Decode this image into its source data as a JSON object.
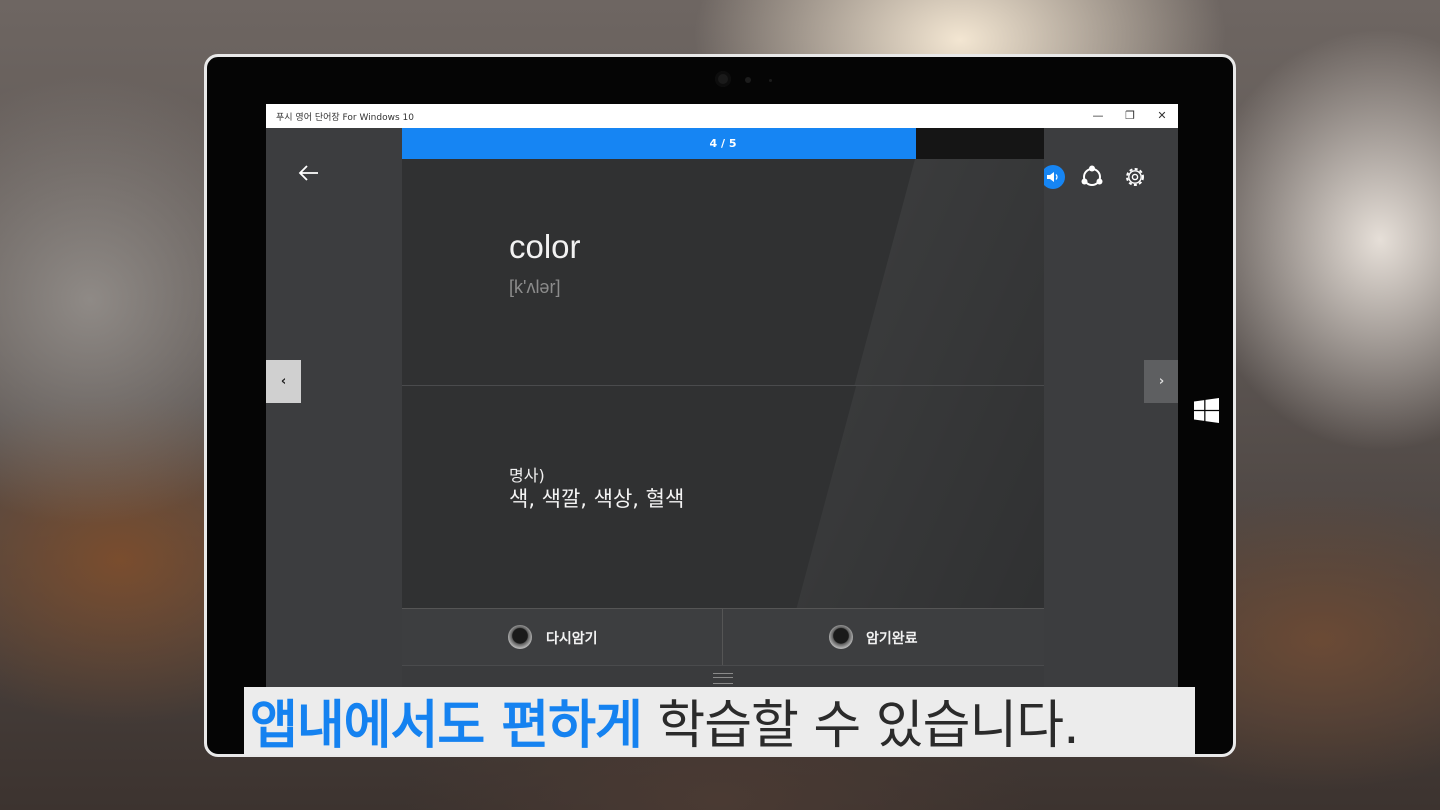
{
  "window": {
    "title": "푸시 영어 단어장 For Windows 10",
    "minimize": "—",
    "restore": "❐",
    "close": "✕"
  },
  "progress": {
    "label": "4 / 5",
    "value": 0.8,
    "color": "#1685f3"
  },
  "card": {
    "word": "color",
    "pronunciation": "[k'ʌlər]",
    "part_of_speech": "명사)",
    "meaning": "색, 색깔, 색상, 혈색"
  },
  "navigation": {
    "prev": "‹",
    "next": "›"
  },
  "buttons": {
    "review_again": "다시암기",
    "memorized": "암기완료"
  },
  "caption": {
    "highlight": "앱내에서도 편하게",
    "rest": " 학습할 수 있습니다."
  },
  "icons": [
    "back-arrow-icon",
    "speaker-icon",
    "share-icon",
    "gear-icon",
    "windows-logo-icon",
    "camera-icon"
  ],
  "colors": {
    "accent": "#1582f0",
    "card": "#303132",
    "background": "#3d3e40"
  }
}
